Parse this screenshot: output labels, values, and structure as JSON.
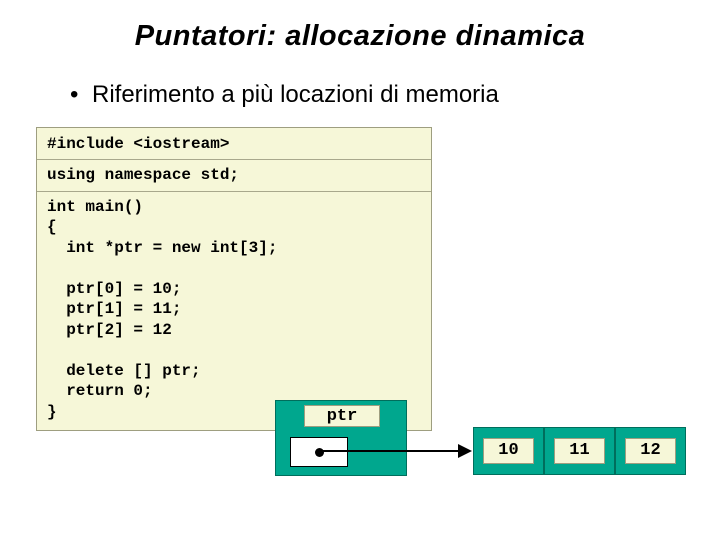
{
  "title": "Puntatori: allocazione dinamica",
  "bullet": {
    "marker": "•",
    "text": "Riferimento a più locazioni di memoria"
  },
  "code": {
    "line1": "#include <iostream>",
    "line2": "using namespace std;",
    "line3": "int main()",
    "line4": "{",
    "line5": "  int *ptr = new int[3];",
    "line6": "  ptr[0] = 10;",
    "line7": "  ptr[1] = 11;",
    "line8": "  ptr[2] = 12",
    "line9": "  delete [] ptr;",
    "line10": "  return 0;",
    "line11": "}"
  },
  "diagram": {
    "ptr_label": "ptr",
    "cells": [
      "10",
      "11",
      "12"
    ]
  }
}
